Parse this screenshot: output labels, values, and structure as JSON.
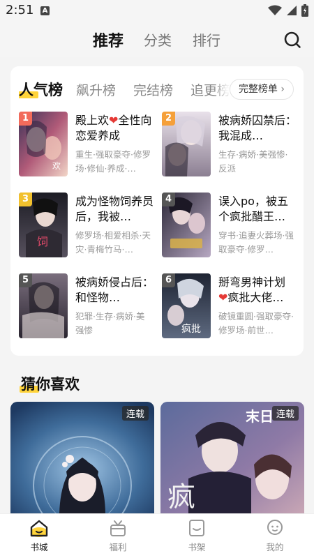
{
  "status_bar": {
    "time": "2:51",
    "notification_icon": "A"
  },
  "top_nav": {
    "tabs": [
      {
        "label": "推荐",
        "active": true
      },
      {
        "label": "分类",
        "active": false
      },
      {
        "label": "排行",
        "active": false
      }
    ],
    "search_icon": "search-icon"
  },
  "ranking": {
    "tabs": [
      {
        "label": "人气榜",
        "active": true
      },
      {
        "label": "飙升榜",
        "active": false
      },
      {
        "label": "完结榜",
        "active": false
      },
      {
        "label": "追更榜",
        "active": false
      }
    ],
    "full_list_label": "完整榜单",
    "books": [
      {
        "rank": "1",
        "title_a": "殿上欢",
        "title_b": "全性向恋爱养成",
        "title_heart": true,
        "tags": "重生·强取豪夺·修罗场·修仙·养成·…",
        "badge_color": "#f26b5b"
      },
      {
        "rank": "2",
        "title": "被病娇囚禁后：我混成…",
        "tags": "生存·病娇·美强惨·反派",
        "badge_color": "#f5a03a"
      },
      {
        "rank": "3",
        "title": "成为怪物饲养员后，我被…",
        "tags": "修罗场·相爱相杀·天灾·青梅竹马·…",
        "badge_color": "#f2c12e"
      },
      {
        "rank": "4",
        "title": "误入po，被五个疯批醋王…",
        "tags": "穿书·追妻火葬场·强取豪夺·修罗…",
        "badge_color": "#555555"
      },
      {
        "rank": "5",
        "title": "被病娇侵占后：和怪物…",
        "tags": "犯罪·生存·病娇·美强惨",
        "badge_color": "#555555"
      },
      {
        "rank": "6",
        "title_a": "掰弯男神计划",
        "title_b": "疯批大佬…",
        "title_heart": true,
        "tags": "破镜重圆·强取豪夺·修罗场·前世…",
        "badge_color": "#555555"
      }
    ]
  },
  "guess_you_like": {
    "title": "猜你喜欢",
    "cards": [
      {
        "status": "连载"
      },
      {
        "status": "连载",
        "cover_text": "末日",
        "cover_text2": "疯"
      }
    ]
  },
  "bottom_nav": [
    {
      "label": "书城",
      "icon": "home-icon",
      "active": true
    },
    {
      "label": "福利",
      "icon": "gift-icon",
      "active": false
    },
    {
      "label": "书架",
      "icon": "bookshelf-icon",
      "active": false
    },
    {
      "label": "我的",
      "icon": "profile-icon",
      "active": false
    }
  ],
  "colors": {
    "accent": "#ffd43b",
    "heart": "#e53935"
  }
}
